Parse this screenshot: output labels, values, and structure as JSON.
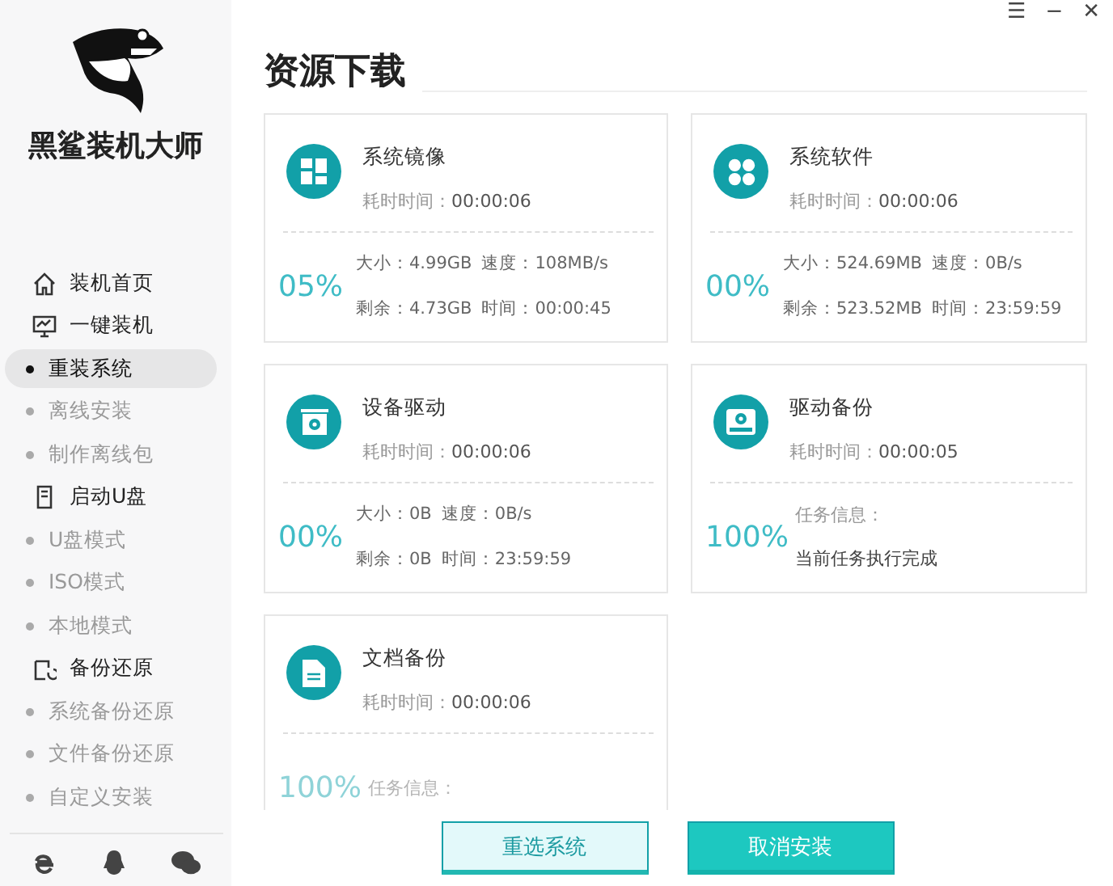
{
  "window_controls": [
    "☰",
    "−",
    "✕"
  ],
  "sidebar": {
    "brand": "黑鲨装机大师",
    "menu": [
      {
        "label": "装机首页"
      },
      {
        "label": "一键装机",
        "children": [
          {
            "label": "重装系统",
            "selected": true
          },
          {
            "label": "离线安装",
            "selected": false
          },
          {
            "label": "制作离线包",
            "selected": false
          }
        ]
      },
      {
        "label": "启动U盘",
        "children": [
          {
            "label": "U盘模式",
            "selected": false
          },
          {
            "label": "ISO模式",
            "selected": false
          },
          {
            "label": "本地模式",
            "selected": false
          }
        ]
      },
      {
        "label": "备份还原",
        "children": [
          {
            "label": "系统备份还原",
            "selected": false
          },
          {
            "label": "文件备份还原",
            "selected": false
          },
          {
            "label": "自定义安装",
            "selected": false
          }
        ]
      }
    ]
  },
  "page": {
    "title": "资源下载"
  },
  "cards": [
    {
      "kind": "transfer",
      "name": "系统镜像",
      "elapsed_label": "耗时时间：",
      "elapsed": "00:00:06",
      "percent": "05%",
      "size": "大小：4.99GB",
      "speed": "速度：108MB/s",
      "remaining": "剩余：4.73GB",
      "time": "时间：00:00:45"
    },
    {
      "kind": "transfer",
      "name": "系统软件",
      "elapsed_label": "耗时时间：",
      "elapsed": "00:00:06",
      "percent": "00%",
      "size": "大小：524.69MB",
      "speed": "速度：0B/s",
      "remaining": "剩余：523.52MB",
      "time": "时间：23:59:59"
    },
    {
      "kind": "transfer",
      "name": "设备驱动",
      "elapsed_label": "耗时时间：",
      "elapsed": "00:00:06",
      "percent": "00%",
      "size": "大小：0B",
      "speed": "速度：0B/s",
      "remaining": "剩余：0B",
      "time": "时间：23:59:59"
    },
    {
      "kind": "task",
      "name": "驱动备份",
      "elapsed_label": "耗时时间：",
      "elapsed": "00:00:05",
      "percent": "100%",
      "info_label": "任务信息：",
      "info_value": "当前任务执行完成"
    },
    {
      "kind": "task",
      "name": "文档备份",
      "elapsed_label": "耗时时间：",
      "elapsed": "00:00:06",
      "percent": "100%",
      "info_label": "任务信息："
    }
  ],
  "buttons": [
    {
      "label": "重选系统",
      "kind": "secondary"
    },
    {
      "label": "取消安装",
      "kind": "primary"
    }
  ]
}
